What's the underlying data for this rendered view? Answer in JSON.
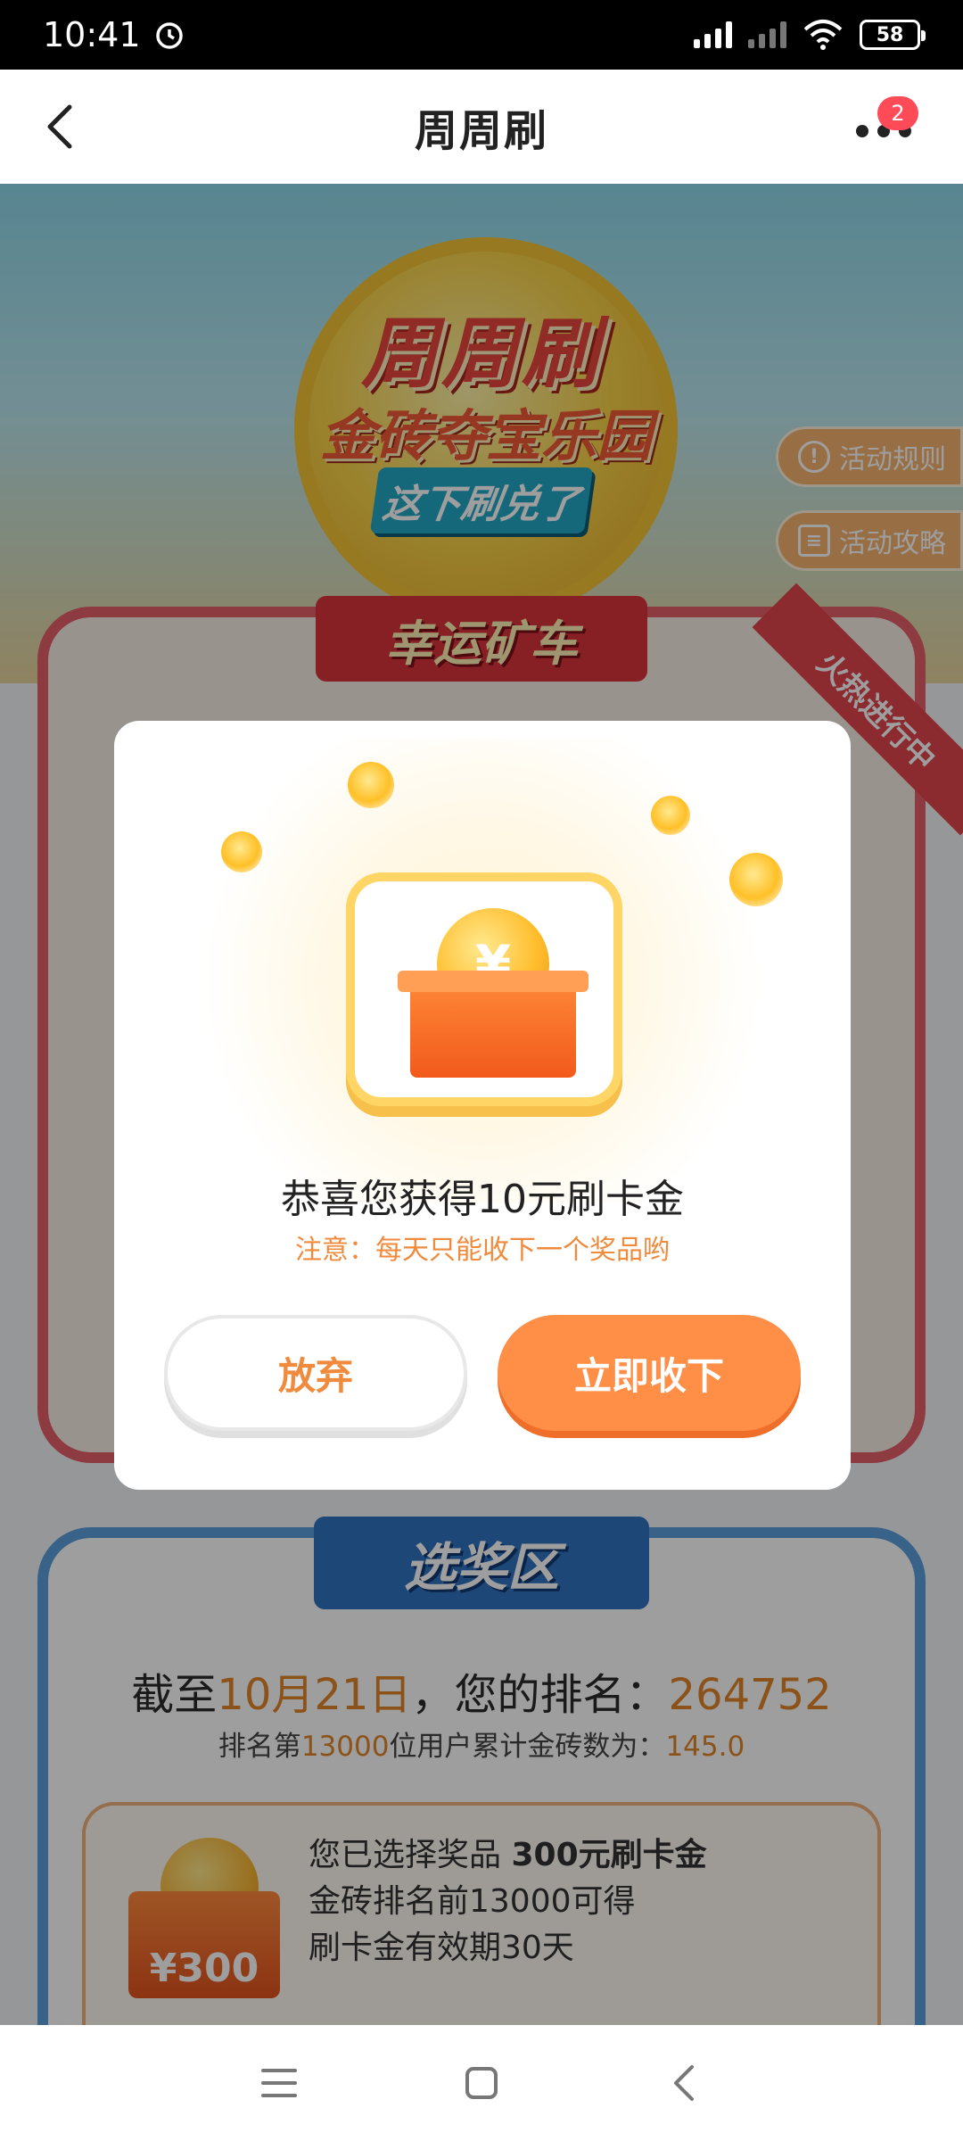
{
  "status_bar": {
    "time": "10:41",
    "battery": "58"
  },
  "nav": {
    "title": "周周刷",
    "badge_count": "2"
  },
  "hero": {
    "title_line1": "周周刷",
    "title_line2": "金砖夺宝乐园",
    "tagline": "这下刷兑了",
    "rules_button": "活动规则",
    "guide_button": "活动攻略"
  },
  "lucky_section": {
    "banner": "幸运矿车",
    "ribbon": "火热进行中"
  },
  "prize_section": {
    "banner": "选奖区",
    "rank_prefix": "截至",
    "rank_date": "10月21日",
    "rank_middle": "，您的排名：",
    "rank_value": "264752",
    "sub_prefix": "排名第",
    "sub_rank": "13000",
    "sub_middle": "位用户累计金砖数为：",
    "sub_value": "145.0",
    "selected_prefix": "您已选择奖品",
    "selected_prize": "300元刷卡金",
    "condition": "金砖排名前13000可得",
    "validity": "刷卡金有效期30天",
    "prize_amount": "¥300"
  },
  "modal": {
    "title": "恭喜您获得10元刷卡金",
    "note": "注意：每天只能收下一个奖品哟",
    "giveup_label": "放弃",
    "accept_label": "立即收下",
    "coin_symbol": "¥"
  },
  "colors": {
    "accent": "#ff8e47",
    "note": "#f08a3c",
    "badge": "#ff4a57"
  }
}
